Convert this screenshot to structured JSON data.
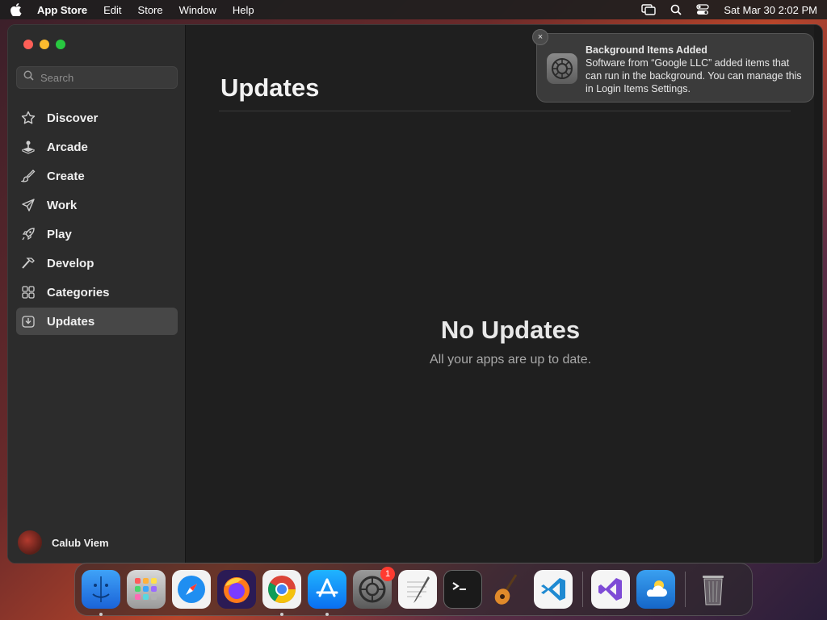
{
  "menubar": {
    "app_name": "App Store",
    "items": [
      "Edit",
      "Store",
      "Window",
      "Help"
    ],
    "datetime": "Sat Mar 30  2:02 PM"
  },
  "sidebar": {
    "search_placeholder": "Search",
    "items": [
      {
        "label": "Discover",
        "icon": "star-icon"
      },
      {
        "label": "Arcade",
        "icon": "joystick-icon"
      },
      {
        "label": "Create",
        "icon": "brush-icon"
      },
      {
        "label": "Work",
        "icon": "paper-plane-icon"
      },
      {
        "label": "Play",
        "icon": "rocket-icon"
      },
      {
        "label": "Develop",
        "icon": "hammer-icon"
      },
      {
        "label": "Categories",
        "icon": "grid-icon"
      },
      {
        "label": "Updates",
        "icon": "download-icon",
        "active": true
      }
    ],
    "user_name": "Calub Viem"
  },
  "main": {
    "title": "Updates",
    "empty_title": "No Updates",
    "empty_subtitle": "All your apps are up to date."
  },
  "notification": {
    "title": "Background Items Added",
    "body": "Software from “Google LLC” added items that can run in the background. You can manage this in Login Items Settings.",
    "close": "×"
  },
  "dock": {
    "settings_badge": "1"
  },
  "colors": {
    "close": "#fe5f57",
    "minimize": "#febc2e",
    "zoom": "#28c840",
    "badge": "#ff3b30"
  }
}
